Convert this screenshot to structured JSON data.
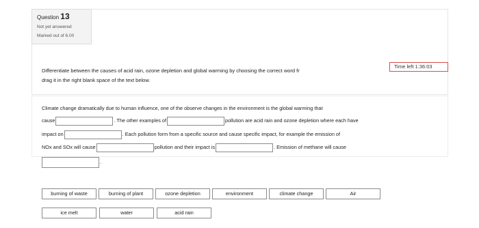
{
  "question": {
    "label": "Question",
    "number": "13",
    "status": "Not yet answered",
    "marks": "Marked out of 6.00"
  },
  "timer": {
    "text": "Time left 1:36:03"
  },
  "instructions": {
    "line1": "Differentiate between the causes of acid rain, ozone depletion and global warming by choosing the correct word fr",
    "line2": "drag it in the right blank space of the text below."
  },
  "passage": {
    "l1": "Climate change dramatically due to human influence, one of the observe changes in the environment is the global warming that",
    "l2a": "cause",
    "l2b": ". The other examples of",
    "l2c": "pollution are acid rain and ozone depletion where each have",
    "l3a": "impact on",
    "l3b": ". Each pollution form from a specific source and cause specific impact, for example the emission of",
    "l4a": "NOx and SOx will cause",
    "l4b": "pollution and their impact is",
    "l4c": ". Emission of methane will cause",
    "l5": "."
  },
  "word_bank": {
    "row1": [
      "burning of waste",
      "burning of plant",
      "ozone depletion",
      "environment",
      "climate change",
      "Air"
    ],
    "row2": [
      "ice melt",
      "water",
      "acid rain"
    ]
  }
}
